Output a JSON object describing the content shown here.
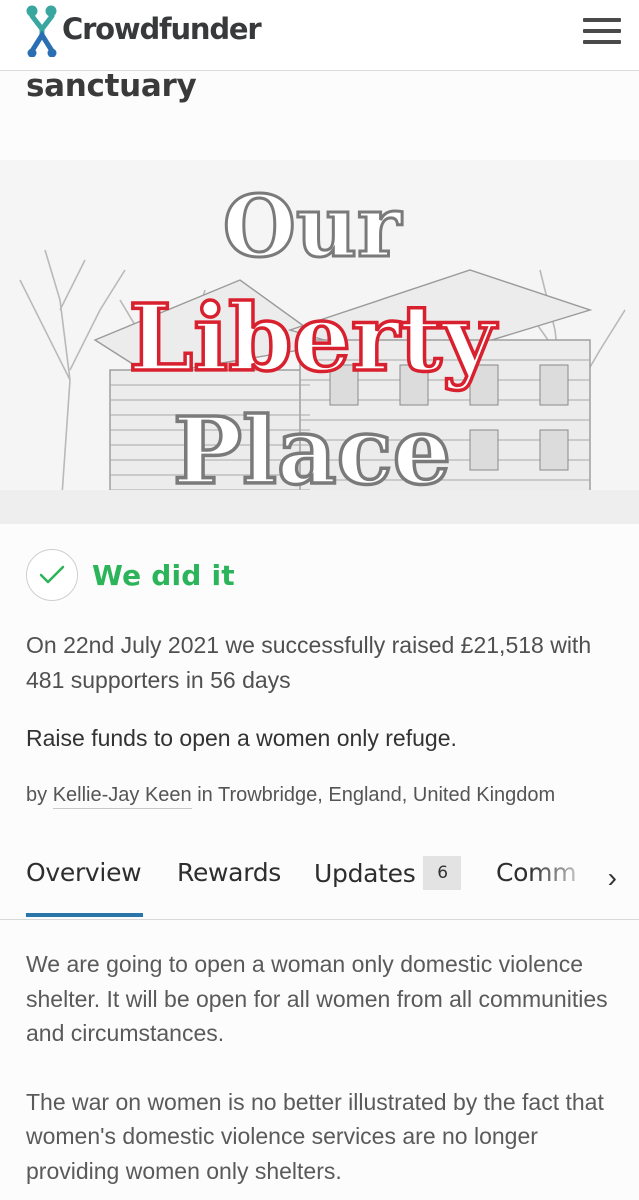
{
  "header": {
    "brand": "Crowdfunder",
    "logo_icon": "crowdfunder-figure-logo",
    "menu_icon": "hamburger-menu-icon"
  },
  "title_partial": "sanctuary",
  "hero": {
    "line1": "Our",
    "line2": "Liberty",
    "line3": "Place",
    "accent": "#d8202e",
    "gray": "#7a7a7a"
  },
  "status": {
    "icon": "check-icon",
    "text": "We did it",
    "color": "#2bb45a"
  },
  "raised_text": "On 22nd July 2021 we successfully raised £21,518 with 481 supporters in 56 days",
  "tagline": "Raise funds to open a women only refuge.",
  "byline": {
    "prefix": "by",
    "author": "Kellie-Jay Keen",
    "location": "in Trowbridge, England, United Kingdom"
  },
  "tabs": [
    {
      "label": "Overview",
      "active": true
    },
    {
      "label": "Rewards"
    },
    {
      "label": "Updates",
      "badge": "6"
    },
    {
      "label": "Comm"
    }
  ],
  "tab_arrow": "›",
  "body": [
    "We are going to open a woman only domestic violence shelter.  It will be open for all women from all communities and circumstances.",
    "The war on women is no better illustrated by the fact that women's domestic violence services are no longer providing women only shelters."
  ]
}
